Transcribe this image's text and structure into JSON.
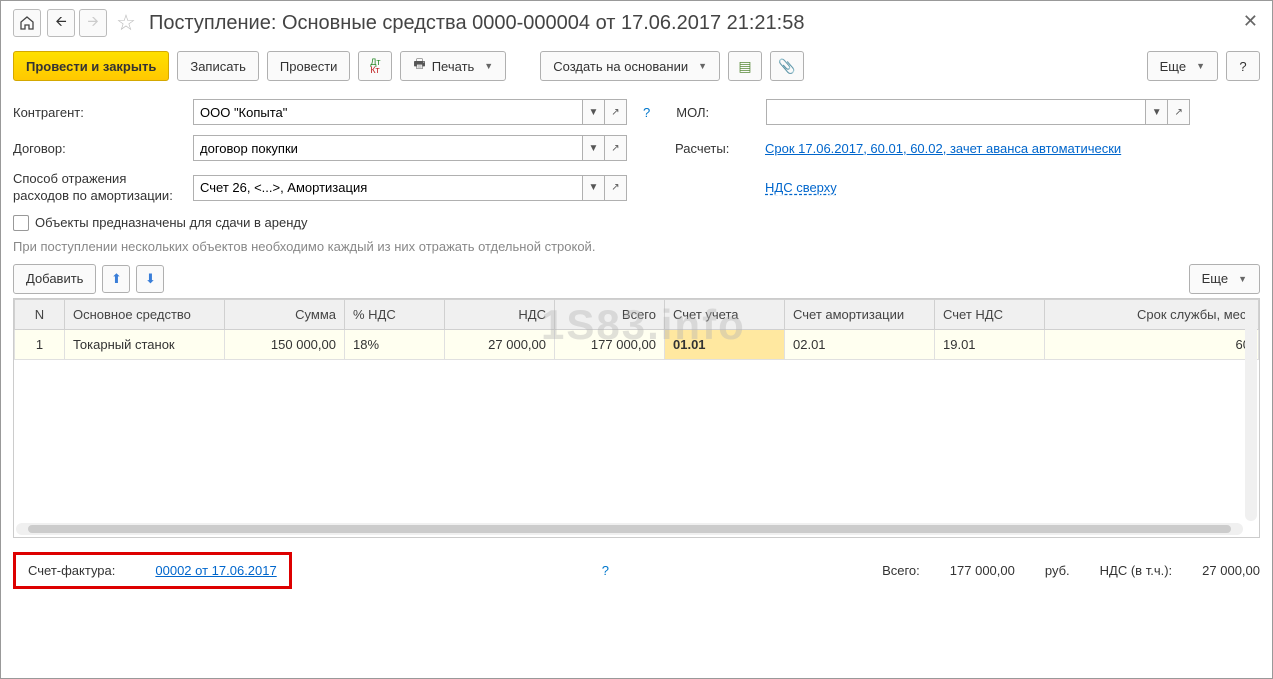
{
  "title": "Поступление: Основные средства 0000-000004 от 17.06.2017 21:21:58",
  "toolbar": {
    "post_close": "Провести и закрыть",
    "save": "Записать",
    "post": "Провести",
    "print": "Печать",
    "create_based": "Создать на основании",
    "more": "Еще",
    "help": "?"
  },
  "form": {
    "counterparty_label": "Контрагент:",
    "counterparty_value": "ООО \"Копыта\"",
    "contract_label": "Договор:",
    "contract_value": "договор покупки",
    "expense_label_l1": "Способ отражения",
    "expense_label_l2": "расходов по амортизации:",
    "expense_value": "Счет 26, <...>, Амортизация",
    "mol_label": "МОЛ:",
    "mol_value": "",
    "settlements_label": "Расчеты:",
    "settlements_link": "Срок 17.06.2017, 60.01, 60.02, зачет аванса автоматически",
    "vat_link": "НДС сверху",
    "lease_checkbox": "Объекты предназначены для сдачи в аренду",
    "hint": "При поступлении нескольких объектов необходимо каждый из них отражать отдельной строкой."
  },
  "table_toolbar": {
    "add": "Добавить",
    "more": "Еще"
  },
  "table": {
    "headers": {
      "n": "N",
      "asset": "Основное средство",
      "sum": "Сумма",
      "vat_pct": "% НДС",
      "vat": "НДС",
      "total": "Всего",
      "account": "Счет учета",
      "amort_account": "Счет амортизации",
      "vat_account": "Счет НДС",
      "life": "Срок службы, мес."
    },
    "rows": [
      {
        "n": "1",
        "asset": "Токарный станок",
        "sum": "150 000,00",
        "vat_pct": "18%",
        "vat": "27 000,00",
        "total": "177 000,00",
        "account": "01.01",
        "amort_account": "02.01",
        "vat_account": "19.01",
        "life": "60"
      }
    ]
  },
  "footer": {
    "invoice_label": "Счет-фактура:",
    "invoice_link": "00002 от 17.06.2017",
    "total_label": "Всего:",
    "total_value": "177 000,00",
    "currency": "руб.",
    "vat_label": "НДС (в т.ч.):",
    "vat_value": "27 000,00"
  },
  "watermark": "1S83.info"
}
